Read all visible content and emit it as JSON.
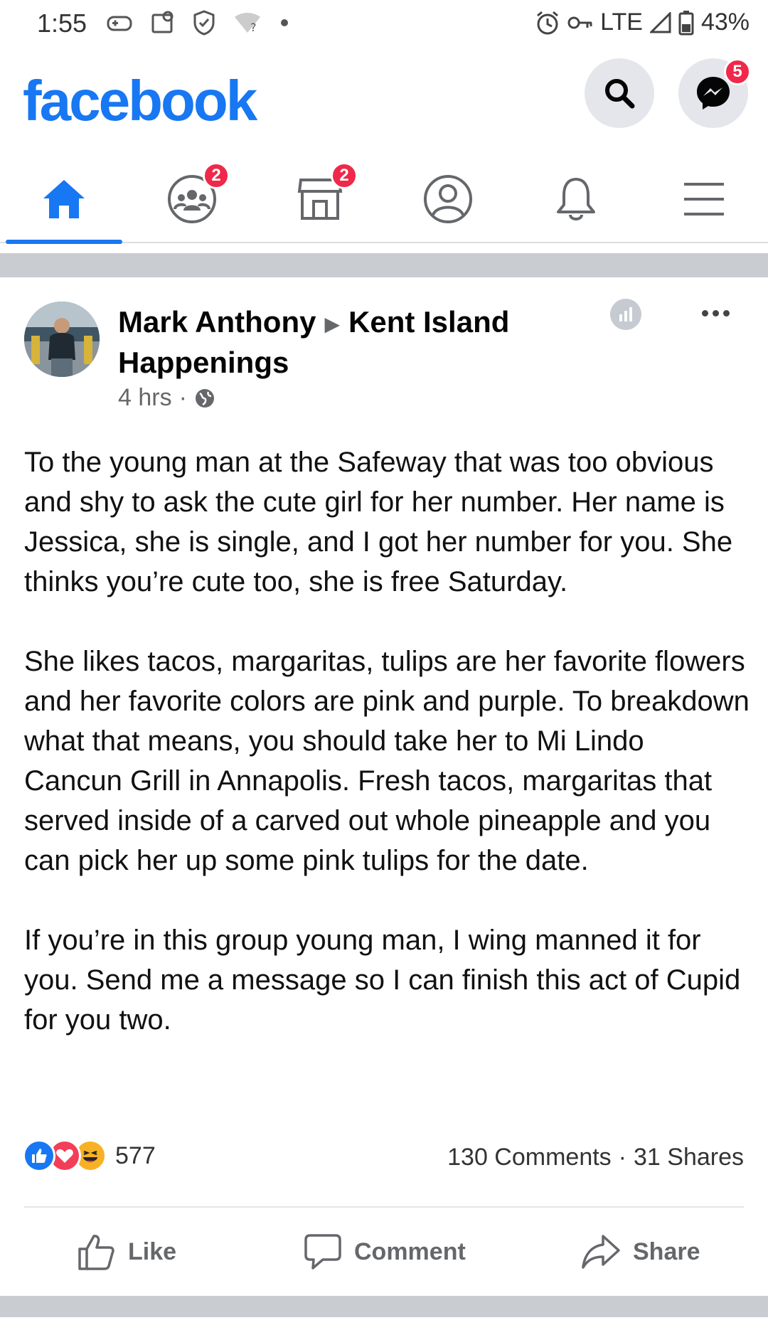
{
  "status_bar": {
    "time": "1:55",
    "network": "LTE",
    "battery": "43%"
  },
  "header": {
    "logo": "facebook",
    "messenger_badge": "5",
    "colors": {
      "brand": "#1877f2",
      "badge": "#f02849",
      "icon_bg": "#e4e6eb"
    }
  },
  "nav": {
    "tabs": [
      {
        "name": "home",
        "icon": "home-icon",
        "active": true
      },
      {
        "name": "groups",
        "icon": "groups-icon",
        "badge": "2"
      },
      {
        "name": "marketplace",
        "icon": "marketplace-icon",
        "badge": "2"
      },
      {
        "name": "profile",
        "icon": "profile-icon"
      },
      {
        "name": "notifications",
        "icon": "bell-icon"
      },
      {
        "name": "menu",
        "icon": "hamburger-icon"
      }
    ]
  },
  "post": {
    "author": "Mark Anthony",
    "group": "Kent Island Happenings",
    "time": "4 hrs",
    "audience_icon": "globe-icon",
    "paragraphs": [
      "To the young man at the Safeway that was too obvious and shy to ask the cute girl for her number. Her name is Jessica, she is single, and I got her number for you.  She thinks you’re cute too, she is free Saturday.",
      "She likes tacos, margaritas, tulips are her favorite flowers and her favorite colors are pink and purple.  To breakdown what that means, you should take her to Mi Lindo Cancun Grill in Annapolis.  Fresh tacos, margaritas that served inside of a carved out whole pineapple and you can pick her up some pink tulips for the date.",
      "If you’re in this group young man, I wing manned it for you.  Send me a message so I can finish this act of Cupid for you two."
    ],
    "reaction_count": "577",
    "comments": "130 Comments",
    "shares": "31 Shares",
    "actions": {
      "like": "Like",
      "comment": "Comment",
      "share": "Share"
    }
  }
}
